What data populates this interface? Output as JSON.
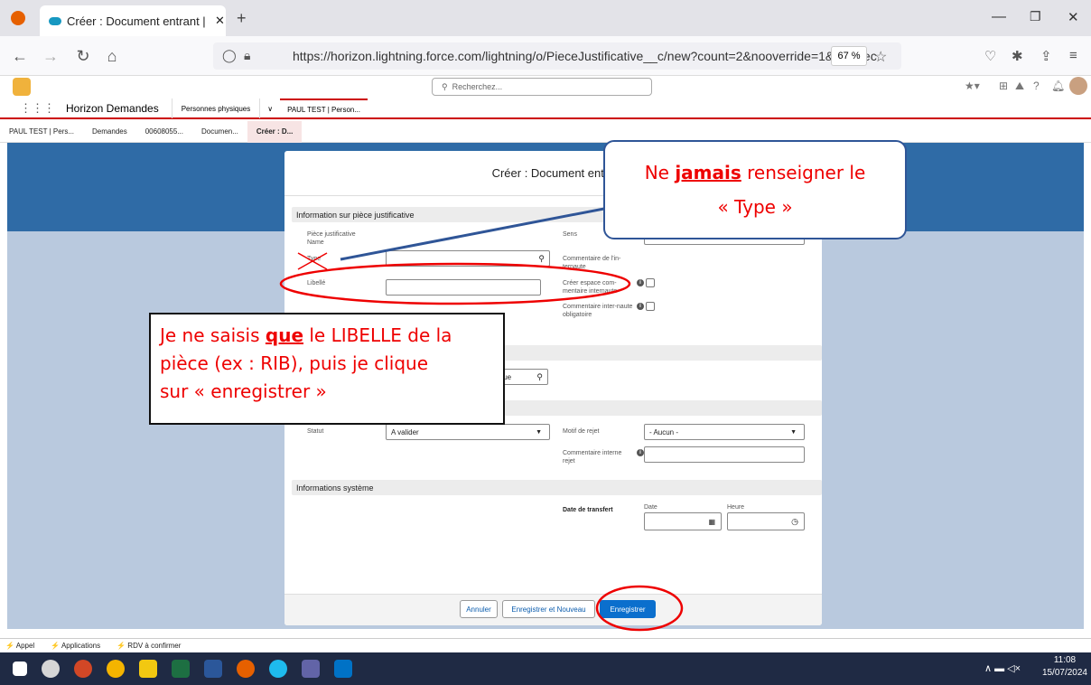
{
  "browser": {
    "tab_title": "Créer : Document entrant | Sale",
    "url": "https://horizon.lightning.force.com/lightning/o/PieceJustificative__c/new?count=2&nooverride=1&useRec",
    "zoom": "67 %"
  },
  "sf": {
    "search_placeholder": "Recherchez...",
    "app_name": "Horizon Demandes",
    "nav_items": [
      "Personnes physiques",
      "PAUL TEST | Person..."
    ],
    "subtabs": [
      "PAUL TEST | Pers...",
      "Demandes",
      "00608055...",
      "Documen...",
      "Créer : D..."
    ]
  },
  "modal": {
    "title": "Créer : Document entra",
    "section1": "Information sur pièce justificative",
    "piece_label": "Pièce justificative Name",
    "type_label": "Type",
    "libelle_label": "Libellé",
    "sens_label": "Sens",
    "commentaire_internaute_label": "Commentaire de l'in-ternaute",
    "creer_espace_label": "Créer espace com-mentaire internaute",
    "commentaire_obligatoire_label": "Commentaire inter-naute obligatoire",
    "physique_value": "ysique",
    "statut_label": "Statut",
    "statut_value": "A valider",
    "motif_label": "Motif de rejet",
    "motif_value": "- Aucun -",
    "commentaire_rejet_label": "Commentaire interne rejet",
    "section_system": "Informations système",
    "date_transfert_label": "Date de transfert",
    "date_label": "Date",
    "heure_label": "Heure",
    "btn_cancel": "Annuler",
    "btn_save_new": "Enregistrer et Nouveau",
    "btn_save": "Enregistrer"
  },
  "callouts": {
    "top_line1_pre": "Ne ",
    "top_line1_bold": "jamais",
    "top_line1_post": " renseigner le",
    "top_line2": "« Type »",
    "left_line1_pre": "Je ne saisis ",
    "left_line1_bold": "que",
    "left_line1_post": " le LIBELLE de la",
    "left_line2": "pièce (ex : RIB), puis je clique",
    "left_line3": "sur « enregistrer »"
  },
  "bottombar": [
    "Appel",
    "Applications",
    "RDV à confirmer"
  ],
  "taskbar": {
    "time": "11:08",
    "date": "15/07/2024"
  },
  "colors": {
    "accent": "#0b6fcd",
    "annotation": "#e00000",
    "header_red": "#cc0000"
  }
}
